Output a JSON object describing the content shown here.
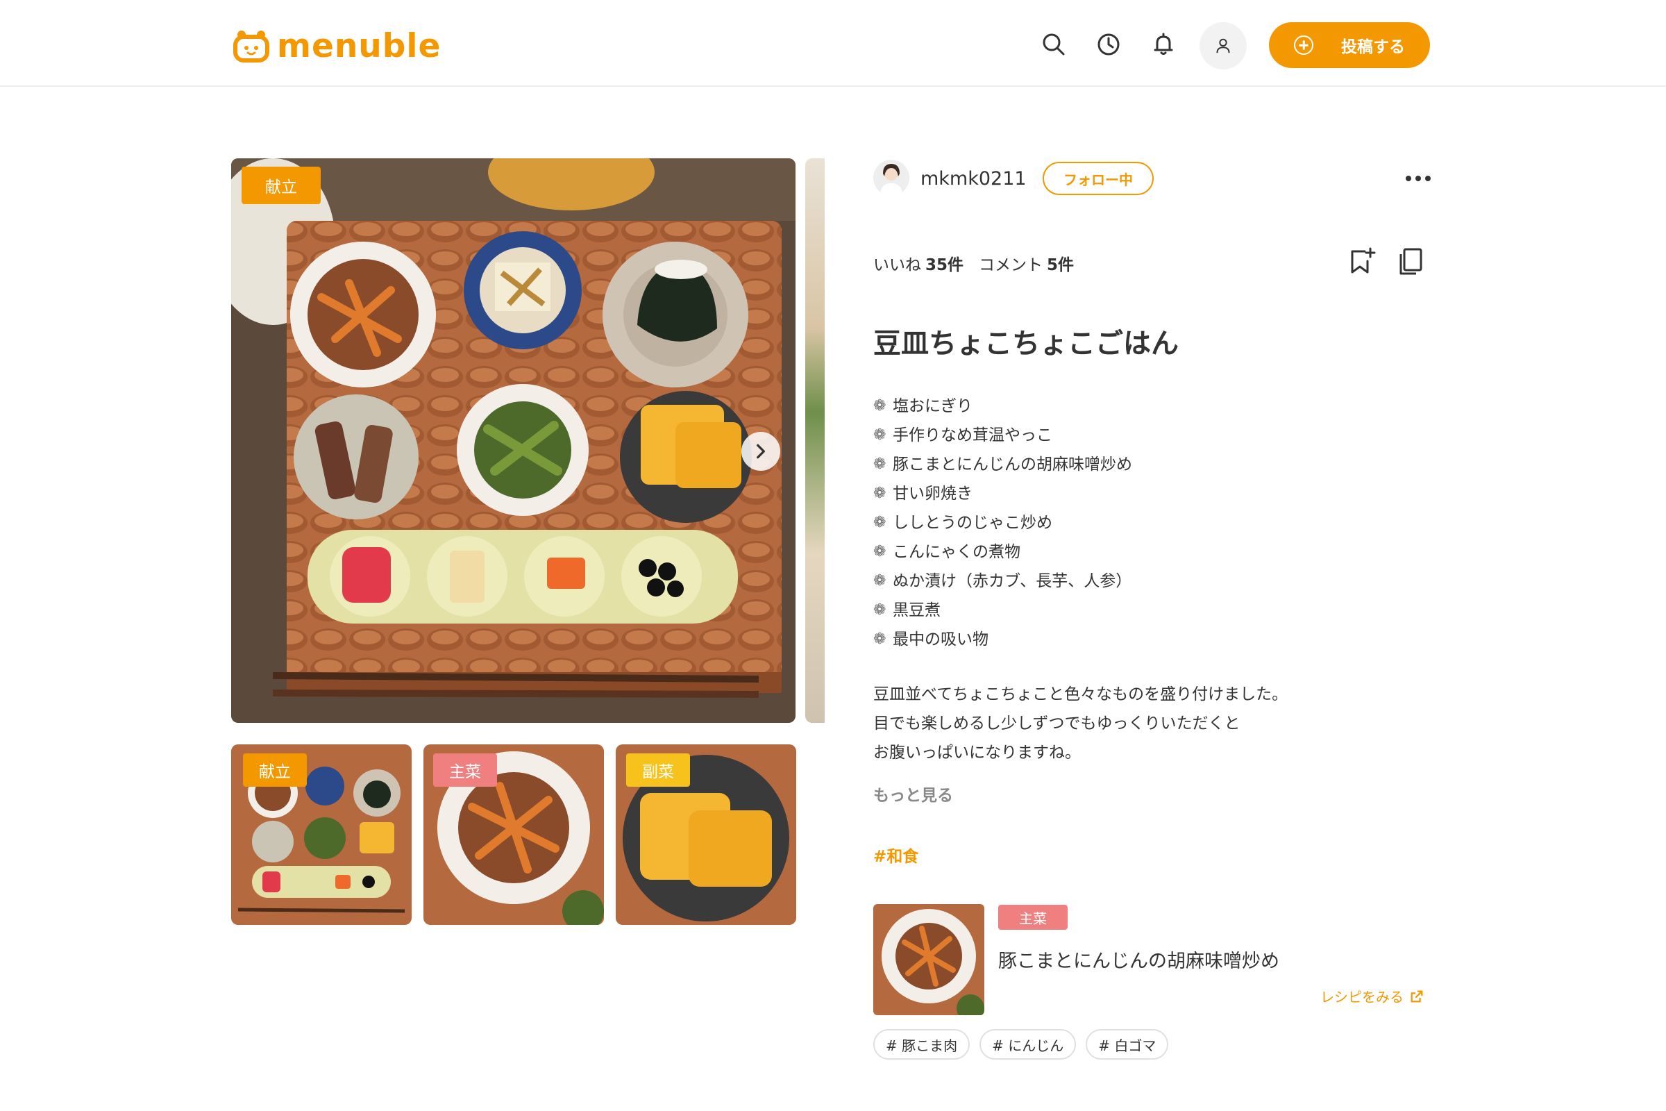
{
  "header": {
    "logo_text": "menuble",
    "post_button_label": "投稿する",
    "icons": [
      "search-icon",
      "history-icon",
      "bell-icon",
      "user-icon",
      "plus-circle-icon"
    ]
  },
  "colors": {
    "brand": "#f39800",
    "main_dish": "#f08080",
    "side_dish": "#f7c21b",
    "menu_badge": "#f39800"
  },
  "post": {
    "main_image_badge": "献立",
    "thumbnails": [
      {
        "badge": "献立"
      },
      {
        "badge": "主菜"
      },
      {
        "badge": "副菜"
      }
    ],
    "author": {
      "name": "mkmk0211",
      "follow_label": "フォロー中"
    },
    "stats": {
      "likes_label": "いいね",
      "likes_value": "35件",
      "comments_label": "コメント",
      "comments_value": "5件"
    },
    "title": "豆皿ちょこちょこごはん",
    "menu_items": [
      "塩おにぎり",
      "手作りなめ茸温やっこ",
      "豚こまとにんじんの胡麻味噌炒め",
      "甘い卵焼き",
      "ししとうのじゃこ炒め",
      "こんにゃくの煮物",
      "ぬか漬け（赤カブ、長芋、人参）",
      "黒豆煮",
      "最中の吸い物"
    ],
    "description": [
      "豆皿並べてちょこちょこと色々なものを盛り付けました。",
      "目でも楽しめるし少しずつでもゆっくりいただくと",
      "お腹いっぱいになりますね。"
    ],
    "more_label": "もっと見る",
    "hashtag": "#和食",
    "recipe": {
      "category": "主菜",
      "name": "豚こまとにんじんの胡麻味噌炒め",
      "link_label": "レシピをみる",
      "tags": [
        "# 豚こま肉",
        "# にんじん",
        "# 白ゴマ"
      ]
    }
  }
}
